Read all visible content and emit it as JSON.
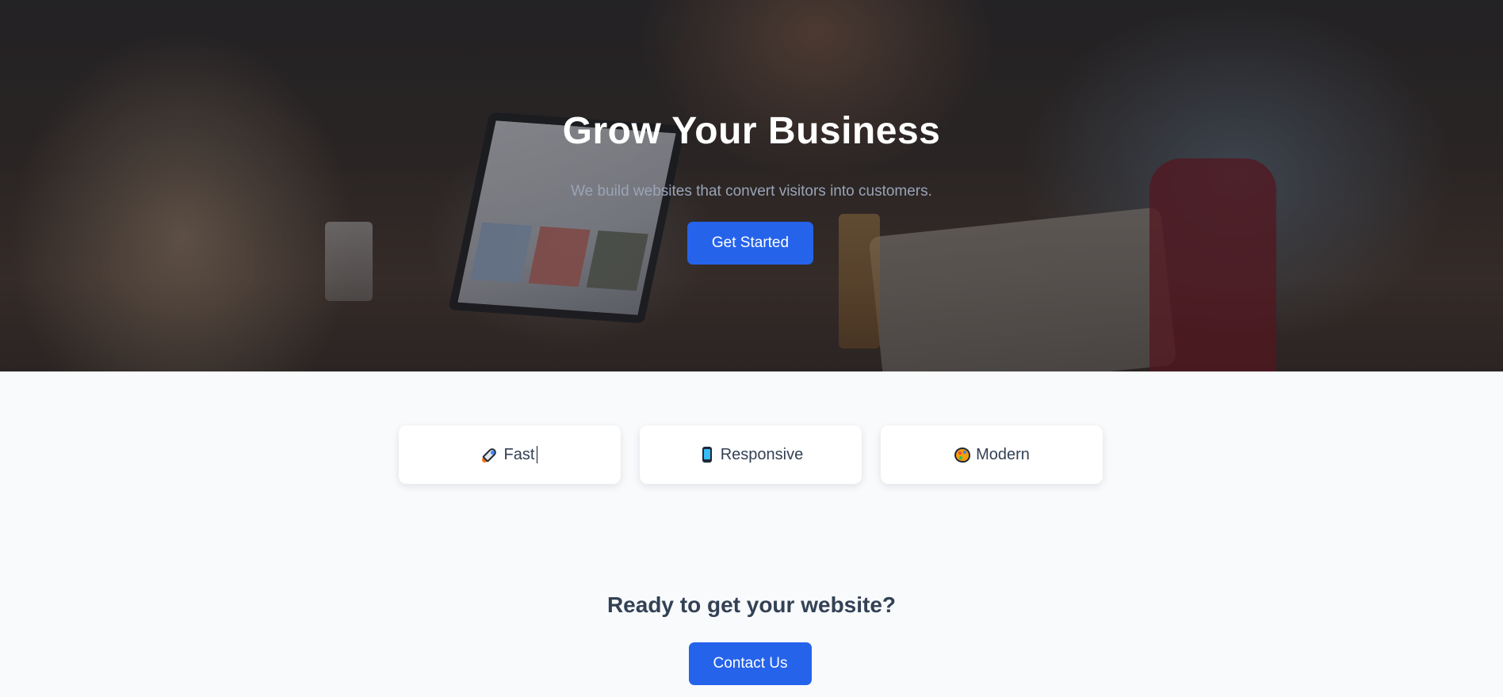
{
  "hero": {
    "title": "Grow Your Business",
    "subtitle": "We build websites that convert visitors into customers.",
    "cta_label": "Get Started"
  },
  "features": [
    {
      "icon": "rocket-icon",
      "label": "Fast"
    },
    {
      "icon": "mobile-phone-icon",
      "label": "Responsive"
    },
    {
      "icon": "palette-icon",
      "label": "Modern"
    }
  ],
  "cta_section": {
    "title": "Ready to get your website?",
    "button_label": "Contact Us"
  },
  "colors": {
    "accent": "#2563eb",
    "page_background": "#f8fafc",
    "heading_text": "#334155",
    "hero_title": "#ffffff",
    "hero_subtitle": "#9aa4b6"
  }
}
